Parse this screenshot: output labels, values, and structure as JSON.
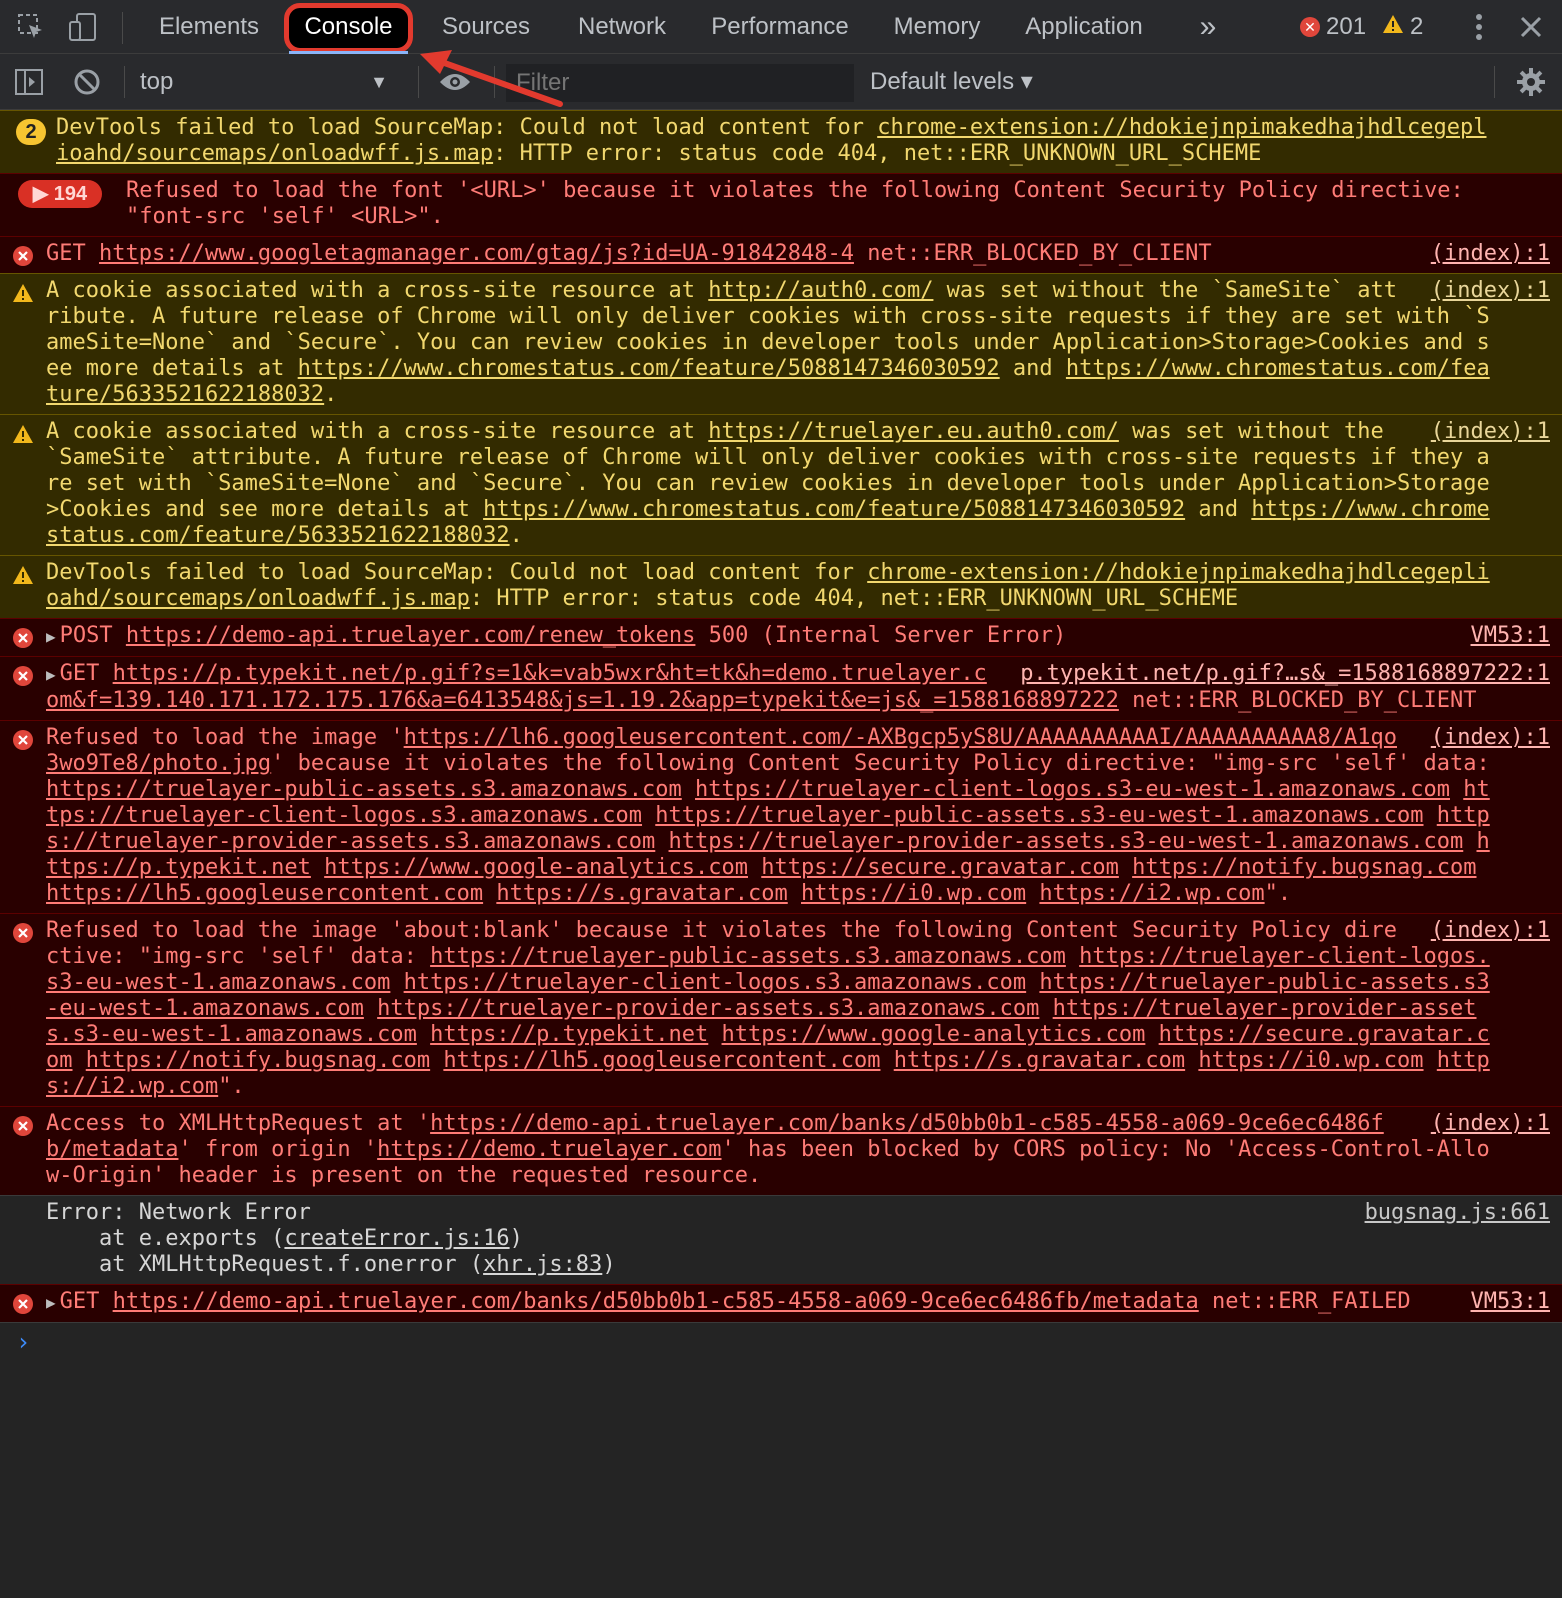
{
  "tabs": {
    "items": [
      "Elements",
      "Console",
      "Sources",
      "Network",
      "Performance",
      "Memory",
      "Application"
    ],
    "more": "»",
    "error_count": "201",
    "warning_count": "2"
  },
  "toolbar": {
    "context": "top",
    "filter_placeholder": "Filter",
    "levels": "Default levels ▾"
  },
  "messages": {
    "m1": {
      "badge": "2",
      "t1": "DevTools failed to load SourceMap: Could not load content for ",
      "link": "chrome-extension://hdokiejnpimakedhajhdlcegeplioahd/sourcemaps/onloadwff.js.map",
      "t2": ": HTTP error: status code 404, net::ERR_UNKNOWN_URL_SCHEME"
    },
    "m2": {
      "badge": "▶ 194",
      "text": "Refused to load the font '<URL>' because it violates the following Content Security Policy directive: \"font-src 'self' <URL>\"."
    },
    "m3": {
      "t1": "GET ",
      "link": "https://www.googletagmanager.com/gtag/js?id=UA-91842848-4",
      "t2": " net::ERR_BLOCKED_BY_CLIENT",
      "src": "(index):1"
    },
    "m4": {
      "t1": "A cookie associated with a cross-site resource at ",
      "link1": "http://auth0.com/",
      "t2": " was set without the `SameSite` attribute. A future release of Chrome will only deliver cookies with cross-site requests if they are set with `SameSite=None` and `Secure`. You can review cookies in developer tools under Application>Storage>Cookies and see more details at ",
      "link2": "https://www.chromestatus.com/feature/5088147346030592",
      "t3": " and ",
      "link3": "https://www.chromestatus.com/feature/5633521622188032",
      "t4": ".",
      "src": "(index):1"
    },
    "m5": {
      "t1": "A cookie associated with a cross-site resource at ",
      "link1": "https://truelayer.eu.auth0.com/",
      "t2": " was set without the `SameSite` attribute. A future release of Chrome will only deliver cookies with cross-site requests if they are set with `SameSite=None` and `Secure`. You can review cookies in developer tools under Application>Storage>Cookies and see more details at ",
      "link2": "https://www.chromestatus.com/feature/5088147346030592",
      "t3": " and ",
      "link3": "https://www.chromestatus.com/feature/5633521622188032",
      "t4": ".",
      "src": "(index):1"
    },
    "m6": {
      "t1": "DevTools failed to load SourceMap: Could not load content for ",
      "link": "chrome-extension://hdokiejnpimakedhajhdlcegeplioahd/sourcemaps/onloadwff.js.map",
      "t2": ": HTTP error: status code 404, net::ERR_UNKNOWN_URL_SCHEME"
    },
    "m7": {
      "t1": "POST ",
      "link": "https://demo-api.truelayer.com/renew_tokens",
      "t2": " 500 (Internal Server Error)",
      "src": "VM53:1"
    },
    "m8": {
      "t1": "GET ",
      "link": "https://p.typekit.net/p.gif?s=1&k=vab5wxr&ht=tk&h=demo.truelayer.com&f=139.140.171.172.175.176&a=6413548&js=1.19.2&app=typekit&e=js&_=1588168897222",
      "t2": " net::ERR_BLOCKED_BY_CLIENT",
      "src": "p.typekit.net/p.gif?…s&_=1588168897222:1"
    },
    "m9": {
      "t1": "Refused to load the image '",
      "link1": "https://lh6.googleusercontent.com/-AXBgcp5yS8U/AAAAAAAAAAI/AAAAAAAAAA8/A1qo3wo9Te8/photo.jpg",
      "t2": "' because it violates the following Content Security Policy directive: \"img-src 'self' data: ",
      "links": [
        "https://truelayer-public-assets.s3.amazonaws.com",
        "https://truelayer-client-logos.s3-eu-west-1.amazonaws.com",
        "https://truelayer-client-logos.s3.amazonaws.com",
        "https://truelayer-public-assets.s3-eu-west-1.amazonaws.com",
        "https://truelayer-provider-assets.s3.amazonaws.com",
        "https://truelayer-provider-assets.s3-eu-west-1.amazonaws.com",
        "https://p.typekit.net",
        "https://www.google-analytics.com",
        "https://secure.gravatar.com",
        "https://notify.bugsnag.com",
        "https://lh5.googleusercontent.com",
        "https://s.gravatar.com",
        "https://i0.wp.com",
        "https://i2.wp.com"
      ],
      "t3": "\".",
      "src": "(index):1"
    },
    "m10": {
      "t1": "Refused to load the image 'about:blank' because it violates the following Content Security Policy directive: \"img-src 'self' data: ",
      "links": [
        "https://truelayer-public-assets.s3.amazonaws.com",
        "https://truelayer-client-logos.s3-eu-west-1.amazonaws.com",
        "https://truelayer-client-logos.s3.amazonaws.com",
        "https://truelayer-public-assets.s3-eu-west-1.amazonaws.com",
        "https://truelayer-provider-assets.s3.amazonaws.com",
        "https://truelayer-provider-assets.s3-eu-west-1.amazonaws.com",
        "https://p.typekit.net",
        "https://www.google-analytics.com",
        "https://secure.gravatar.com",
        "https://notify.bugsnag.com",
        "https://lh5.googleusercontent.com",
        "https://s.gravatar.com",
        "https://i0.wp.com",
        "https://i2.wp.com"
      ],
      "t3": "\".",
      "src": "(index):1"
    },
    "m11": {
      "t1": "Access to XMLHttpRequest at '",
      "link1": "https://demo-api.truelayer.com/banks/d50bb0b1-c585-4558-a069-9ce6ec6486fb/metadata",
      "t2": "' from origin '",
      "link2": "https://demo.truelayer.com",
      "t3": "' has been blocked by CORS policy: No 'Access-Control-Allow-Origin' header is present on the requested resource.",
      "src": "(index):1"
    },
    "m12": {
      "line1": "Error: Network Error",
      "line2a": "    at e.exports (",
      "link2": "createError.js:16",
      "line2b": ")",
      "line3a": "    at XMLHttpRequest.f.onerror (",
      "link3": "xhr.js:83",
      "line3b": ")",
      "src": "bugsnag.js:661"
    },
    "m13": {
      "t1": "GET ",
      "link": "https://demo-api.truelayer.com/banks/d50bb0b1-c585-4558-a069-9ce6ec6486fb/metadata",
      "t2": " net::ERR_FAILED",
      "src": "VM53:1"
    }
  },
  "prompt": "›",
  "colors": {
    "accent": "#8ab4f8",
    "highlight": "#e23a2e",
    "error_bg": "#290000",
    "warning_bg": "#332b00"
  }
}
